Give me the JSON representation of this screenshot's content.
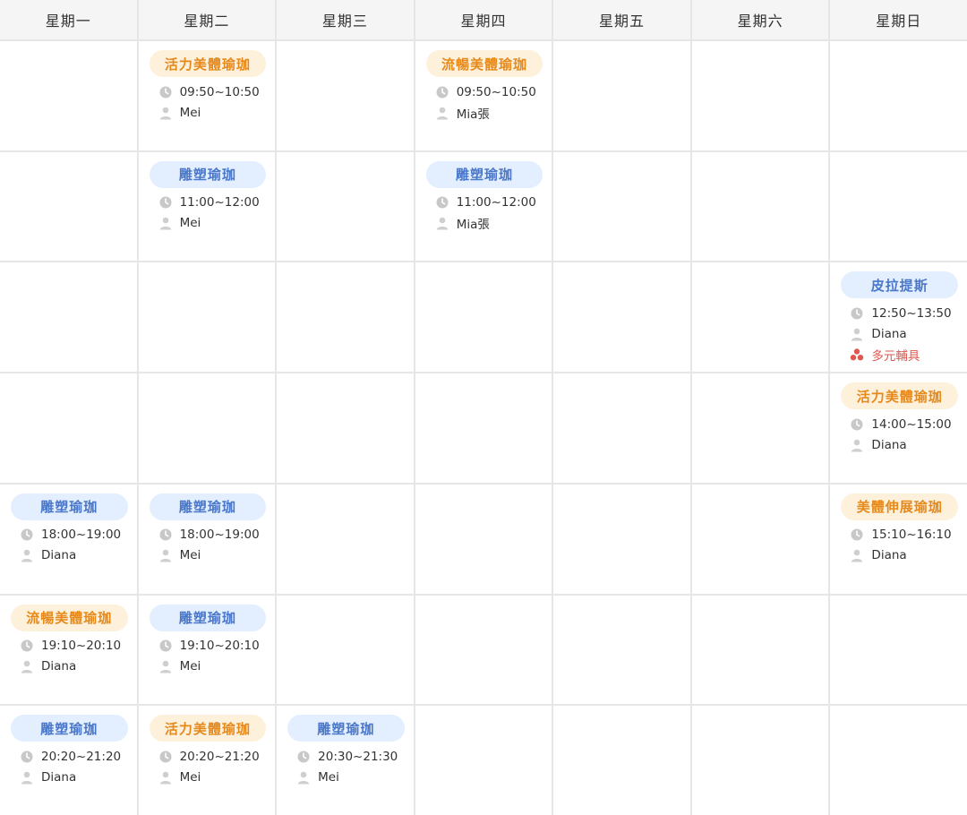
{
  "days": [
    "星期一",
    "星期二",
    "星期三",
    "星期四",
    "星期五",
    "星期六",
    "星期日"
  ],
  "colors": {
    "orange": "#e6891b",
    "blue": "#4a77c9",
    "tag": "#e0574f"
  },
  "classes": [
    {
      "day": 1,
      "slot": 0,
      "name": "活力美體瑜珈",
      "color": "orange",
      "time": "09:50~10:50",
      "teacher": "Mei"
    },
    {
      "day": 3,
      "slot": 0,
      "name": "流暢美體瑜珈",
      "color": "orange",
      "time": "09:50~10:50",
      "teacher": "Mia張"
    },
    {
      "day": 1,
      "slot": 1,
      "name": "雕塑瑜珈",
      "color": "blue",
      "time": "11:00~12:00",
      "teacher": "Mei"
    },
    {
      "day": 3,
      "slot": 1,
      "name": "雕塑瑜珈",
      "color": "blue",
      "time": "11:00~12:00",
      "teacher": "Mia張"
    },
    {
      "day": 6,
      "slot": 2,
      "name": "皮拉提斯",
      "color": "blue",
      "time": "12:50~13:50",
      "teacher": "Diana",
      "tag": "多元輔具"
    },
    {
      "day": 6,
      "slot": 3,
      "name": "活力美體瑜珈",
      "color": "orange",
      "time": "14:00~15:00",
      "teacher": "Diana"
    },
    {
      "day": 0,
      "slot": 4,
      "name": "雕塑瑜珈",
      "color": "blue",
      "time": "18:00~19:00",
      "teacher": "Diana"
    },
    {
      "day": 1,
      "slot": 4,
      "name": "雕塑瑜珈",
      "color": "blue",
      "time": "18:00~19:00",
      "teacher": "Mei"
    },
    {
      "day": 6,
      "slot": 4,
      "name": "美體伸展瑜珈",
      "color": "orange",
      "time": "15:10~16:10",
      "teacher": "Diana"
    },
    {
      "day": 0,
      "slot": 5,
      "name": "流暢美體瑜珈",
      "color": "orange",
      "time": "19:10~20:10",
      "teacher": "Diana"
    },
    {
      "day": 1,
      "slot": 5,
      "name": "雕塑瑜珈",
      "color": "blue",
      "time": "19:10~20:10",
      "teacher": "Mei"
    },
    {
      "day": 0,
      "slot": 6,
      "name": "雕塑瑜珈",
      "color": "blue",
      "time": "20:20~21:20",
      "teacher": "Diana"
    },
    {
      "day": 1,
      "slot": 6,
      "name": "活力美體瑜珈",
      "color": "orange",
      "time": "20:20~21:20",
      "teacher": "Mei"
    },
    {
      "day": 2,
      "slot": 6,
      "name": "雕塑瑜珈",
      "color": "blue",
      "time": "20:30~21:30",
      "teacher": "Mei"
    }
  ],
  "icons": {
    "time": "clock-icon",
    "teacher": "person-icon",
    "tag": "equipment-icon"
  }
}
